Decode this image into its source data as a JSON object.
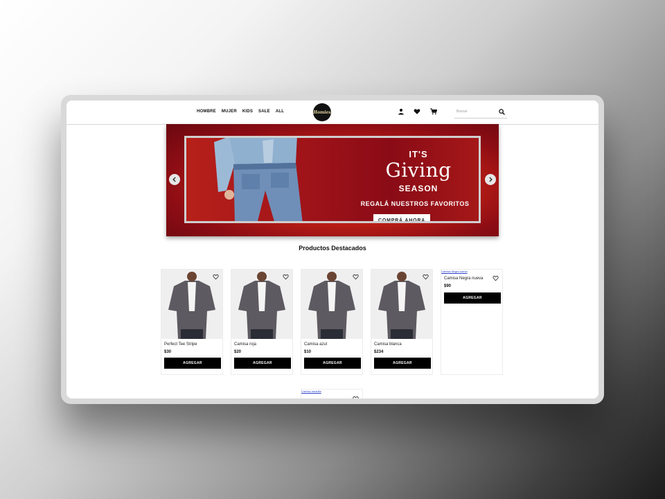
{
  "nav": {
    "items": [
      "HOMBRE",
      "MUJER",
      "KIDS",
      "SALE",
      "ALL"
    ]
  },
  "logo": {
    "text": "Homies"
  },
  "header_icons": [
    "user-icon",
    "heart-icon",
    "cart-icon"
  ],
  "search": {
    "placeholder": "Buscar",
    "value": ""
  },
  "banner": {
    "line1": "IT'S",
    "line2": "Giving",
    "line3": "SEASON",
    "line4": "REGALÁ NUESTROS FAVORITOS",
    "cta": "COMPRÁ AHORA"
  },
  "section_title": "Productos Destacados",
  "products": [
    {
      "name": "Perfect Tee Stripe",
      "price": "$30",
      "button": "AGREGAR"
    },
    {
      "name": "Camisa roja",
      "price": "$20",
      "button": "AGREGAR"
    },
    {
      "name": "Camisa azul",
      "price": "$10",
      "button": "AGREGAR"
    },
    {
      "name": "Camisa blanca",
      "price": "$234",
      "button": "AGREGAR"
    },
    {
      "name": "Camisa Negra nueva",
      "alt": "Camisa Negra nueva",
      "price": "$90",
      "button": "AGREGAR"
    }
  ],
  "partial_product": {
    "alt": "Camisa amarilla"
  },
  "colors": {
    "accent": "#000000",
    "banner_red": "#c82416"
  }
}
